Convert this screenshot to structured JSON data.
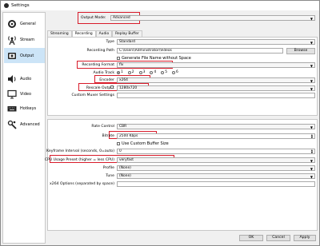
{
  "window": {
    "title": "Settings"
  },
  "sidebar": {
    "items": [
      {
        "label": "General",
        "icon": "gear-icon"
      },
      {
        "label": "Stream",
        "icon": "antenna-icon"
      },
      {
        "label": "Output",
        "icon": "output-icon",
        "selected": true
      },
      {
        "label": "Audio",
        "icon": "speaker-icon"
      },
      {
        "label": "Video",
        "icon": "monitor-icon"
      },
      {
        "label": "Hotkeys",
        "icon": "keyboard-icon"
      },
      {
        "label": "Advanced",
        "icon": "wrench-gear-icon"
      }
    ]
  },
  "output_mode": {
    "label": "Output Mode",
    "value": "Advanced"
  },
  "tabs": [
    "Streaming",
    "Recording",
    "Audio",
    "Replay Buffer"
  ],
  "active_tab": "Recording",
  "recording": {
    "type_label": "Type",
    "type_value": "Standard",
    "path_label": "Recording Path",
    "path_value": "C:\\Users\\Administrator\\Videos",
    "browse_label": "Browse",
    "no_space_label": "Generate File Name without Space",
    "format_label": "Recording Format",
    "format_value": "flv",
    "audio_track_label": "Audio Track",
    "audio_tracks": [
      "1",
      "2",
      "3",
      "4",
      "5",
      "6"
    ],
    "encoder_label": "Encoder",
    "encoder_value": "x264",
    "rescale_label": "Rescale Output",
    "rescale_value": "1280x720",
    "muxer_label": "Custom Muxer Settings"
  },
  "encoder": {
    "rate_control_label": "Rate Control",
    "rate_control_value": "CBR",
    "bitrate_label": "Bitrate",
    "bitrate_value": "2500 Kbps",
    "custom_buffer_label": "Use Custom Buffer Size",
    "keyframe_label": "Keyframe Interval (seconds, 0=auto)",
    "keyframe_value": "0",
    "preset_label": "CPU Usage Preset (higher = less CPU)",
    "preset_value": "veryfast",
    "profile_label": "Profile",
    "profile_value": "(None)",
    "tune_label": "Tune",
    "tune_value": "(None)",
    "x264_label": "x264 Options (separated by space)"
  },
  "footer": {
    "ok": "OK",
    "cancel": "Cancel",
    "apply": "Apply"
  },
  "colors": {
    "highlight": "#d81b2a",
    "selection": "#cce4f7"
  }
}
